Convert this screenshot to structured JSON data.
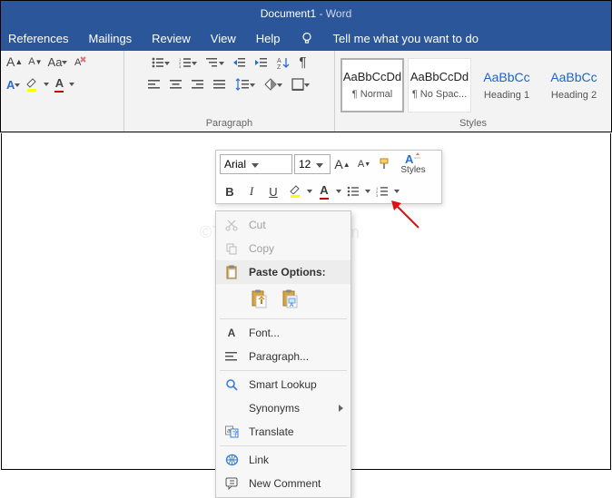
{
  "title": {
    "doc": "Document1",
    "sep": "  -  ",
    "app": "Word"
  },
  "menu": {
    "references": "References",
    "mailings": "Mailings",
    "review": "Review",
    "view": "View",
    "help": "Help",
    "tellme": "Tell me what you want to do"
  },
  "ribbon": {
    "paragraph_label": "Paragraph",
    "styles_label": "Styles"
  },
  "styles": {
    "items": [
      {
        "sample": "AaBbCcDd",
        "label": "¶ Normal"
      },
      {
        "sample": "AaBbCcDd",
        "label": "¶ No Spac..."
      },
      {
        "sample": "AaBbCc",
        "label": "Heading 1"
      },
      {
        "sample": "AaBbCc",
        "label": "Heading 2"
      }
    ]
  },
  "mini": {
    "font": "Arial",
    "size": "12",
    "styles_label": "Styles",
    "bold": "B",
    "italic": "I",
    "underline": "U"
  },
  "ctx": {
    "cut": "Cut",
    "copy": "Copy",
    "paste_header": "Paste Options:",
    "font": "Font...",
    "paragraph": "Paragraph...",
    "smart": "Smart Lookup",
    "synonyms": "Synonyms",
    "translate": "Translate",
    "link": "Link",
    "comment": "New Comment"
  },
  "watermark": "©TheGeekPage.com"
}
